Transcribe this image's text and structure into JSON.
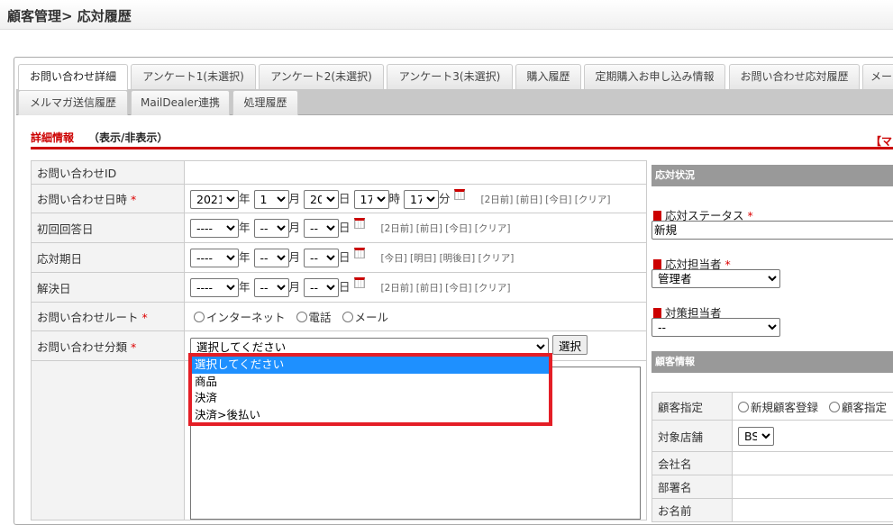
{
  "header": {
    "title": "顧客管理> 応対履歴"
  },
  "tabs": [
    "お問い合わせ詳細",
    "アンケート1(未選択)",
    "アンケート2(未選択)",
    "アンケート3(未選択)",
    "購入履歴",
    "定期購入お申し込み情報",
    "お問い合わせ応対履歴",
    "メール",
    "メルマガ送信履歴",
    "MailDealer連携",
    "処理履歴"
  ],
  "section": {
    "title": "詳細情報",
    "toggle": "（表示/非表示）",
    "right_mark": "【マ"
  },
  "form": {
    "id_label": "お問い合わせID",
    "datetime_label": "お問い合わせ日時",
    "required": "*",
    "year": "2021",
    "month": "1",
    "day": "20",
    "hour": "17",
    "minute": "17",
    "u_year": "年",
    "u_month": "月",
    "u_day": "日",
    "u_hour": "時",
    "u_min": "分",
    "links_a": "[2日前] [前日] [今日] [クリア]",
    "links_b": "[今日] [明日] [明後日] [クリア]",
    "first_reply_label": "初回回答日",
    "due_label": "応対期日",
    "resolved_label": "解決日",
    "empty_year": "----",
    "empty_md": "--",
    "route_label": "お問い合わせルート",
    "routes": [
      "インターネット",
      "電話",
      "メール"
    ],
    "category_label": "お問い合わせ分類",
    "category_value": "選択してください",
    "select_button": "選択",
    "category_options": [
      "選択してください",
      "商品",
      "決済",
      "決済>後払い"
    ]
  },
  "status": {
    "header": "応対状況",
    "status_label": "応対ステータス",
    "status_value": "新規",
    "assignee_label": "応対担当者",
    "assignee_value": "管理者",
    "measure_label": "対策担当者",
    "measure_value": "--"
  },
  "customer": {
    "header": "顧客情報",
    "spec_label": "顧客指定",
    "spec_options": [
      "新規顧客登録",
      "顧客指定"
    ],
    "shop_label": "対象店舗",
    "shop_value": "BS",
    "company_label": "会社名",
    "dept_label": "部署名",
    "name_label": "お名前"
  }
}
